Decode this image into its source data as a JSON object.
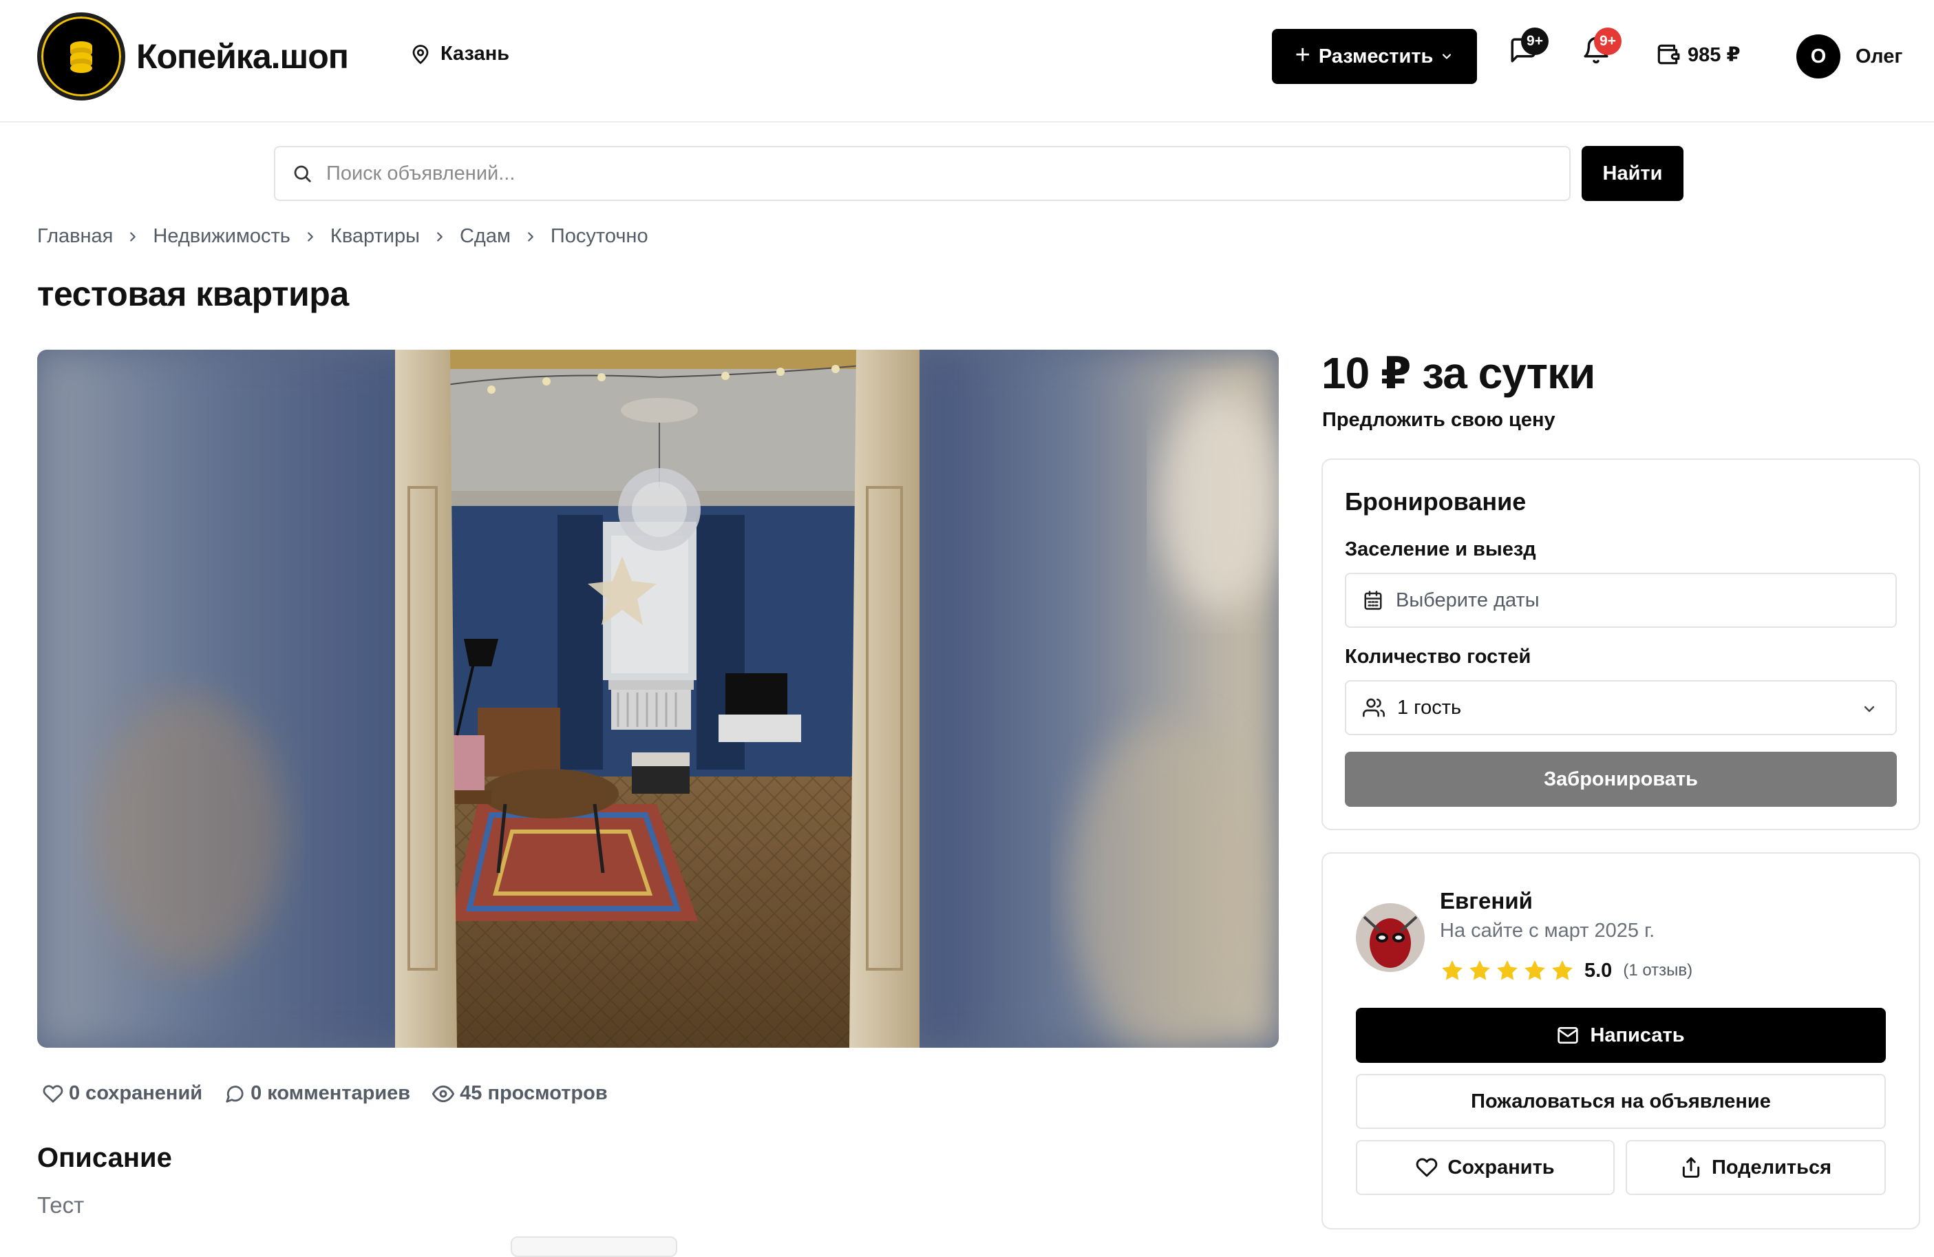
{
  "header": {
    "logo_text": "Копейка.шоп",
    "city": "Казань",
    "post_button_label": "Разместить",
    "messages_badge": "9+",
    "notifications_badge": "9+",
    "wallet_balance": "985 ₽",
    "user_initial": "О",
    "user_name": "Олег"
  },
  "search": {
    "placeholder": "Поиск объявлений...",
    "button_label": "Найти"
  },
  "breadcrumb": [
    "Главная",
    "Недвижимость",
    "Квартиры",
    "Сдам",
    "Посуточно"
  ],
  "listing": {
    "title": "тестовая квартира",
    "price": "10 ₽ за сутки",
    "offer_link": "Предложить свою цену",
    "stats": {
      "saves": "0 сохранений",
      "comments": "0 комментариев",
      "views": "45 просмотров"
    },
    "description_heading": "Описание",
    "description": "Тест"
  },
  "booking": {
    "heading": "Бронирование",
    "dates_label": "Заселение и выезд",
    "dates_placeholder": "Выберите даты",
    "guests_label": "Количество гостей",
    "guests_value": "1 гость",
    "book_button": "Забронировать"
  },
  "seller": {
    "name": "Евгений",
    "since": "На сайте с март 2025 г.",
    "rating": 5,
    "rating_text": "5.0",
    "reviews": "(1 отзыв)",
    "write_button": "Написать",
    "report_button": "Пожаловаться на объявление",
    "save_button": "Сохранить",
    "share_button": "Поделиться"
  },
  "colors": {
    "accent": "#000000",
    "badge_messages": "#111111",
    "badge_notifications": "#e53935",
    "book_button_disabled": "#7a7a7a",
    "star": "#f5c518",
    "logo_coin": "#f3c300"
  },
  "icons": {
    "city": "map-pin-icon",
    "messages": "chat-icon",
    "notifications": "bell-icon",
    "wallet": "wallet-icon",
    "search": "search-icon",
    "dates": "calendar-icon",
    "guests": "users-icon",
    "write": "mail-icon",
    "save": "heart-icon",
    "share": "share-icon"
  }
}
